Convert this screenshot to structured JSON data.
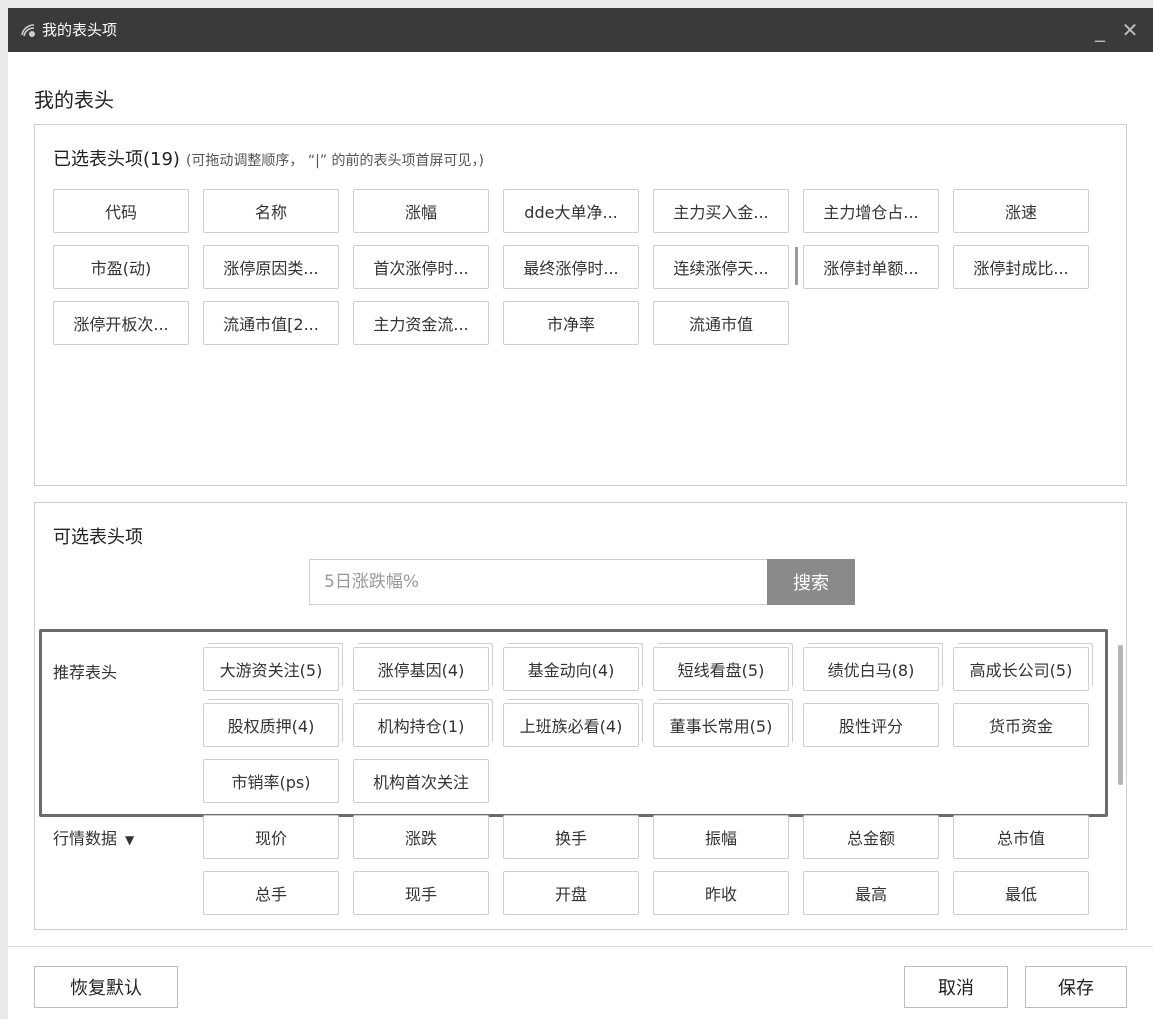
{
  "window": {
    "title": "我的表头项",
    "minimize": "_",
    "close": "✕"
  },
  "page_title": "我的表头",
  "selected": {
    "heading": "已选表头项(19)",
    "hint": "(可拖动调整顺序，  “|” 的前的表头项首屏可见，)",
    "items": [
      "代码",
      "名称",
      "涨幅",
      "dde大单净...",
      "主力买入金...",
      "主力增仓占...",
      "涨速",
      "市盈(动)",
      "涨停原因类...",
      "首次涨停时...",
      "最终涨停时...",
      "连续涨停天...",
      "涨停封单额...",
      "涨停封成比...",
      "涨停开板次...",
      "流通市值[2...",
      "主力资金流...",
      "市净率",
      "流通市值"
    ]
  },
  "available": {
    "heading": "可选表头项",
    "search": {
      "placeholder": "5日涨跌幅%",
      "button": "搜索"
    },
    "recommend_label": "推荐表头",
    "recommend_items": [
      "大游资关注(5)",
      "涨停基因(4)",
      "基金动向(4)",
      "短线看盘(5)",
      "绩优白马(8)",
      "高成长公司(5)",
      "股权质押(4)",
      "机构持仓(1)",
      "上班族必看(4)",
      "董事长常用(5)",
      "股性评分",
      "货币资金",
      "市销率(ps)",
      "机构首次关注"
    ],
    "market_label": "行情数据",
    "market_caret": "▼",
    "market_items": [
      "现价",
      "涨跌",
      "换手",
      "振幅",
      "总金额",
      "总市值",
      "总手",
      "现手",
      "开盘",
      "昨收",
      "最高",
      "最低"
    ]
  },
  "footer": {
    "restore": "恢复默认",
    "cancel": "取消",
    "save": "保存"
  }
}
